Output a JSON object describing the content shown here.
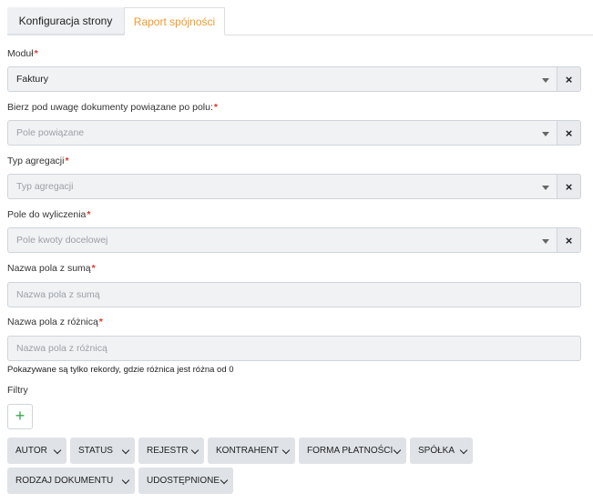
{
  "tabs": [
    {
      "label": "Konfiguracja strony",
      "active": false
    },
    {
      "label": "Raport spójności",
      "active": true
    }
  ],
  "colors": {
    "accent": "#f29a2e",
    "required": "#e0352b",
    "add_icon": "#3aa64a"
  },
  "fields": {
    "module": {
      "label": "Moduł",
      "required_mark": "*",
      "value": "Faktury",
      "clear": "×"
    },
    "related": {
      "label": "Bierz pod uwagę dokumenty powiązane po polu:",
      "required_mark": "*",
      "placeholder": "Pole powiązane",
      "clear": "×"
    },
    "aggregation": {
      "label": "Typ agregacji",
      "required_mark": "*",
      "placeholder": "Typ agregacji",
      "clear": "×"
    },
    "calc_field": {
      "label": "Pole do wyliczenia",
      "required_mark": "*",
      "placeholder": "Pole kwoty docelowej",
      "clear": "×"
    },
    "sum_name": {
      "label": "Nazwa pola z sumą",
      "required_mark": "*",
      "placeholder": "Nazwa pola z sumą",
      "value": ""
    },
    "diff_name": {
      "label": "Nazwa pola z różnicą",
      "required_mark": "*",
      "placeholder": "Nazwa pola z różnicą",
      "value": ""
    }
  },
  "hint": "Pokazywane są tylko rekordy, gdzie różnica jest różna od 0",
  "filters": {
    "label": "Filtry",
    "add_icon": "+",
    "chips": [
      "AUTOR",
      "STATUS",
      "REJESTR",
      "KONTRAHENT",
      "FORMA PŁATNOŚCI",
      "SPÓŁKA",
      "RODZAJ DOKUMENTU",
      "UDOSTĘPNIONE"
    ]
  }
}
